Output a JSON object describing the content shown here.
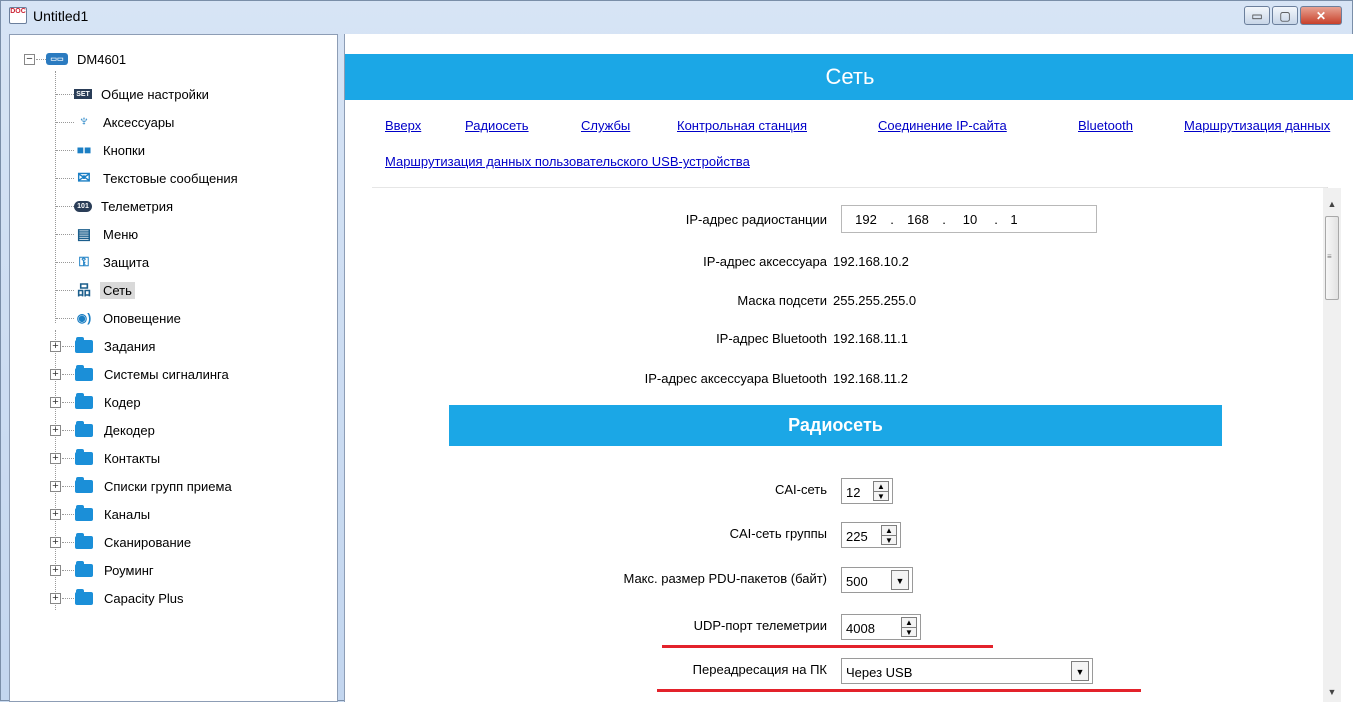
{
  "window": {
    "title": "Untitled1",
    "icon_text": "DOC",
    "buttons": {
      "minimize": "▭",
      "maximize": "▢",
      "close": "✕"
    }
  },
  "tree": {
    "root": "DM4601",
    "items": [
      {
        "label": "Общие настройки",
        "icon": "settings-icon"
      },
      {
        "label": "Аксессуары",
        "icon": "accessory-icon"
      },
      {
        "label": "Кнопки",
        "icon": "buttons-icon"
      },
      {
        "label": "Текстовые сообщения",
        "icon": "envelope-icon"
      },
      {
        "label": "Телеметрия",
        "icon": "telemetry-icon"
      },
      {
        "label": "Меню",
        "icon": "menu-icon"
      },
      {
        "label": "Защита",
        "icon": "key-icon"
      },
      {
        "label": "Сеть",
        "icon": "network-icon",
        "selected": true
      },
      {
        "label": "Оповещение",
        "icon": "alert-icon"
      }
    ],
    "folders": [
      "Задания",
      "Системы сигналинга",
      "Кодер",
      "Декодер",
      "Контакты",
      "Списки групп приема",
      "Каналы",
      "Сканирование",
      "Роуминг",
      "Capacity Plus"
    ]
  },
  "content": {
    "title": "Сеть",
    "links": [
      "Вверх",
      "Радиосеть",
      "Службы",
      "Контрольная станция",
      "Соединение IP-сайта",
      "Bluetooth",
      "Маршрутизация данных",
      "Маршрутизация данных пользовательского USB-устройства"
    ],
    "fields": {
      "radio_ip_label": "IP-адрес радиостанции",
      "radio_ip": [
        "192",
        "168",
        "10",
        "1"
      ],
      "ip_dot": ".",
      "accessory_ip_label": "IP-адрес аксессуара",
      "accessory_ip": "192.168.10.2",
      "subnet_label": "Маска подсети",
      "subnet": "255.255.255.0",
      "bt_ip_label": "IP-адрес Bluetooth",
      "bt_ip": "192.168.11.1",
      "bt_acc_ip_label": "IP-адрес аксессуара Bluetooth",
      "bt_acc_ip": "192.168.11.2"
    },
    "section": "Радиосеть",
    "radio": {
      "cai_label": "CAI-сеть",
      "cai_value": "12",
      "cai_group_label": "CAI-сеть группы",
      "cai_group_value": "225",
      "pdu_label": "Макс. размер PDU-пакетов (байт)",
      "pdu_value": "500",
      "udp_label": "UDP-порт телеметрии",
      "udp_value": "4008",
      "forward_label": "Переадресация на ПК",
      "forward_value": "Через USB"
    }
  }
}
